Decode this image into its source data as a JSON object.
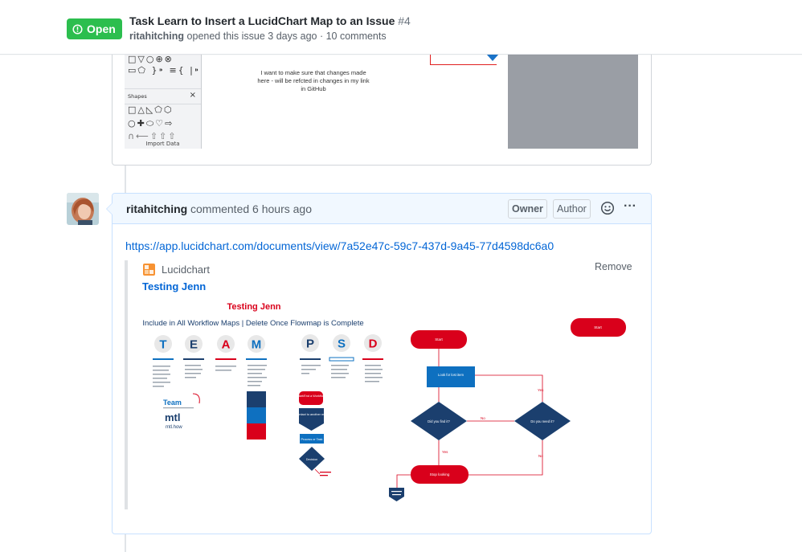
{
  "header": {
    "state_label": "Open",
    "state_color": "#2cbe4e",
    "title": "Task Learn to Insert a LucidChart Map to an Issue",
    "number": "#4",
    "meta_author": "ritahitching",
    "meta_text": "opened this issue 3 days ago · 10 comments"
  },
  "prev_comment": {
    "note_text": "I want to make sure that changes made here - will be refcted in changes in my link in GitHub",
    "shapes_label": "Shapes",
    "import_label": "Import Data"
  },
  "comment": {
    "author": "ritahitching",
    "time_text": "commented 6 hours ago",
    "owner_label": "Owner",
    "author_label": "Author",
    "link": "https://app.lucidchart.com/documents/view/7a52e47c-59c7-437d-9a45-77d4598dc6a0",
    "unfurl": {
      "app_name": "Lucidchart",
      "remove_label": "Remove",
      "title": "Testing Jenn"
    }
  },
  "diagram": {
    "heading": "Testing Jenn",
    "subheading": "Include in All Workflow Maps |  Delete Once Flowmap is Complete",
    "team_letters": [
      "T",
      "E",
      "A",
      "M"
    ],
    "psd_letters": [
      "P",
      "S",
      "D"
    ],
    "team_logo": "Team",
    "mtl_logo": "mtl",
    "mtl_sub": "mtl.how",
    "legend_boxes": [
      "Start/End a Workflow",
      "Contact to another map",
      "Process or Task",
      "Decision"
    ],
    "flow": {
      "start1": "Start",
      "start2": "Start",
      "process": "Look for lost item",
      "decision1": "Did you find it?",
      "decision2": "Do you need it?",
      "stop": "Stop looking",
      "label_no": "No",
      "label_yes": "Yes",
      "label_yes2": "Yes",
      "label_no2": "No"
    },
    "colors": {
      "red": "#d9001b",
      "blue": "#0e70c0",
      "navy": "#1b3f6e"
    }
  }
}
